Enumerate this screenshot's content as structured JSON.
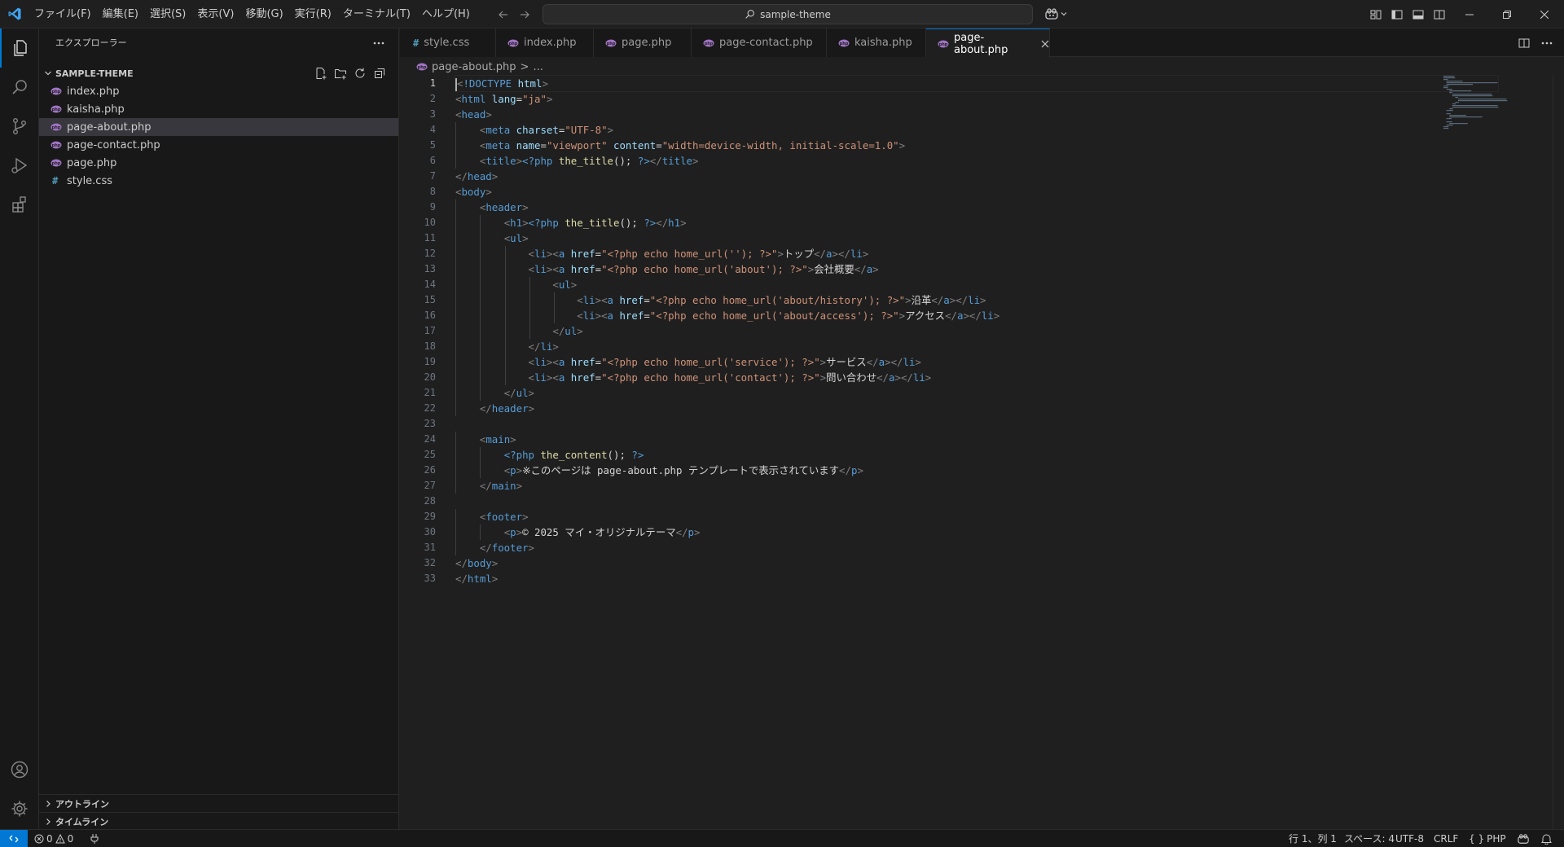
{
  "colors": {
    "accent": "#0078d4",
    "php_icon": "#a074c4",
    "css_icon": "#519aba"
  },
  "menu": [
    "ファイル(F)",
    "編集(E)",
    "選択(S)",
    "表示(V)",
    "移動(G)",
    "実行(R)",
    "ターミナル(T)",
    "ヘルプ(H)"
  ],
  "command_center": {
    "text": "sample-theme"
  },
  "explorer": {
    "title": "エクスプローラー",
    "folder": "SAMPLE-THEME",
    "files": [
      {
        "name": "index.php",
        "type": "php"
      },
      {
        "name": "kaisha.php",
        "type": "php"
      },
      {
        "name": "page-about.php",
        "type": "php",
        "selected": true
      },
      {
        "name": "page-contact.php",
        "type": "php"
      },
      {
        "name": "page.php",
        "type": "php"
      },
      {
        "name": "style.css",
        "type": "css"
      }
    ],
    "outline_label": "アウトライン",
    "timeline_label": "タイムライン"
  },
  "tabs": [
    {
      "label": "style.css",
      "type": "css"
    },
    {
      "label": "index.php",
      "type": "php"
    },
    {
      "label": "page.php",
      "type": "php"
    },
    {
      "label": "page-contact.php",
      "type": "php"
    },
    {
      "label": "kaisha.php",
      "type": "php"
    },
    {
      "label": "page-about.php",
      "type": "php",
      "active": true
    }
  ],
  "breadcrumb": {
    "file": "page-about.php",
    "sep": ">",
    "rest": "..."
  },
  "editor": {
    "current_line": 1,
    "lines": [
      "<!DOCTYPE html>",
      "<html lang=\"ja\">",
      "<head>",
      "    <meta charset=\"UTF-8\">",
      "    <meta name=\"viewport\" content=\"width=device-width, initial-scale=1.0\">",
      "    <title><?php the_title(); ?></title>",
      "</head>",
      "<body>",
      "    <header>",
      "        <h1><?php the_title(); ?></h1>",
      "        <ul>",
      "            <li><a href=\"<?php echo home_url(''); ?>\">トップ</a></li>",
      "            <li><a href=\"<?php echo home_url('about'); ?>\">会社概要</a>",
      "                <ul>",
      "                    <li><a href=\"<?php echo home_url('about/history'); ?>\">沿革</a></li>",
      "                    <li><a href=\"<?php echo home_url('about/access'); ?>\">アクセス</a></li>",
      "                </ul>",
      "            </li>",
      "            <li><a href=\"<?php echo home_url('service'); ?>\">サービス</a></li>",
      "            <li><a href=\"<?php echo home_url('contact'); ?>\">問い合わせ</a></li>",
      "        </ul>",
      "    </header>",
      "",
      "    <main>",
      "        <?php the_content(); ?>",
      "        <p>※このページは page-about.php テンプレートで表示されています</p>",
      "    </main>",
      "",
      "    <footer>",
      "        <p>© 2025 マイ・オリジナルテーマ</p>",
      "    </footer>",
      "</body>",
      "</html>"
    ]
  },
  "status": {
    "errors": "0",
    "warnings": "0",
    "position": "行 1、列 1",
    "spaces": "スペース: 4",
    "encoding": "UTF-8",
    "eol": "CRLF",
    "language_braces": "{ }",
    "language": "PHP"
  }
}
